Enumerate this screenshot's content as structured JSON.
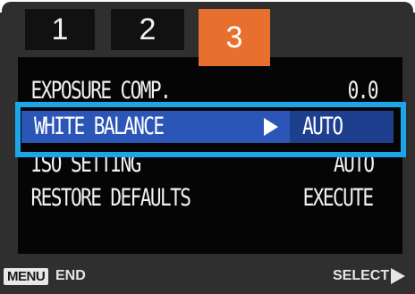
{
  "tabs": [
    {
      "label": "1",
      "active": false
    },
    {
      "label": "2",
      "active": false
    },
    {
      "label": "3",
      "active": true
    }
  ],
  "menu": {
    "rows": [
      {
        "label": "EXPOSURE COMP.",
        "value": "0.0",
        "selected": false
      },
      {
        "label": "WHITE BALANCE",
        "value": "AUTO",
        "selected": true,
        "icon": "arrow-right-icon"
      },
      {
        "label": "ISO SETTING",
        "value": "AUTO",
        "selected": false
      },
      {
        "label": "RESTORE DEFAULTS",
        "value": "EXECUTE",
        "selected": false
      }
    ]
  },
  "footer": {
    "menu_key": "MENU",
    "end_label": "END",
    "select_label": "SELECT",
    "select_icon": "arrow-right-icon"
  },
  "colors": {
    "active_tab": "#e8702f",
    "selection_frame": "#1aa6e8",
    "highlight": "#2b56b8"
  }
}
